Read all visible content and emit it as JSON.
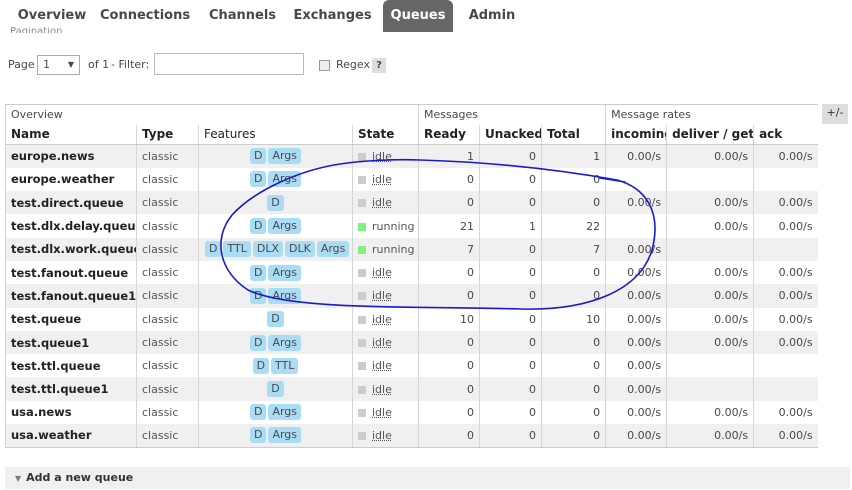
{
  "nav": {
    "tabs": [
      {
        "label": "Overview",
        "active": false
      },
      {
        "label": "Connections",
        "active": false
      },
      {
        "label": "Channels",
        "active": false
      },
      {
        "label": "Exchanges",
        "active": false
      },
      {
        "label": "Queues",
        "active": true
      },
      {
        "label": "Admin",
        "active": false
      }
    ]
  },
  "pagination": {
    "legend": "Pagination",
    "page_label": "Page",
    "page_value": "1",
    "of_label": "of 1",
    "filter_label": "- Filter:",
    "filter_value": "",
    "regex_label": "Regex",
    "help_label": "?"
  },
  "table": {
    "group_headers": {
      "overview": "Overview",
      "messages": "Messages",
      "message_rates": "Message rates"
    },
    "columns": [
      "Name",
      "Type",
      "Features",
      "State",
      "Ready",
      "Unacked",
      "Total",
      "incoming",
      "deliver / get",
      "ack"
    ],
    "plus_minus": "+/-",
    "rows": [
      {
        "name": "europe.news",
        "type": "classic",
        "features": [
          "D",
          "Args"
        ],
        "state": "idle",
        "ready": "1",
        "unacked": "0",
        "total": "1",
        "incoming": "0.00/s",
        "deliver": "0.00/s",
        "ack": "0.00/s"
      },
      {
        "name": "europe.weather",
        "type": "classic",
        "features": [
          "D",
          "Args"
        ],
        "state": "idle",
        "ready": "0",
        "unacked": "0",
        "total": "0",
        "incoming": "",
        "deliver": "",
        "ack": ""
      },
      {
        "name": "test.direct.queue",
        "type": "classic",
        "features": [
          "D"
        ],
        "state": "idle",
        "ready": "0",
        "unacked": "0",
        "total": "0",
        "incoming": "0.00/s",
        "deliver": "0.00/s",
        "ack": "0.00/s"
      },
      {
        "name": "test.dlx.delay.queue",
        "type": "classic",
        "features": [
          "D",
          "Args"
        ],
        "state": "running",
        "ready": "21",
        "unacked": "1",
        "total": "22",
        "incoming": "",
        "deliver": "0.00/s",
        "ack": "0.00/s"
      },
      {
        "name": "test.dlx.work.queue",
        "type": "classic",
        "features": [
          "D",
          "TTL",
          "DLX",
          "DLK",
          "Args"
        ],
        "state": "running",
        "ready": "7",
        "unacked": "0",
        "total": "7",
        "incoming": "0.00/s",
        "deliver": "",
        "ack": ""
      },
      {
        "name": "test.fanout.queue",
        "type": "classic",
        "features": [
          "D",
          "Args"
        ],
        "state": "idle",
        "ready": "0",
        "unacked": "0",
        "total": "0",
        "incoming": "0.00/s",
        "deliver": "0.00/s",
        "ack": "0.00/s"
      },
      {
        "name": "test.fanout.queue1",
        "type": "classic",
        "features": [
          "D",
          "Args"
        ],
        "state": "idle",
        "ready": "0",
        "unacked": "0",
        "total": "0",
        "incoming": "0.00/s",
        "deliver": "0.00/s",
        "ack": "0.00/s"
      },
      {
        "name": "test.queue",
        "type": "classic",
        "features": [
          "D"
        ],
        "state": "idle",
        "ready": "10",
        "unacked": "0",
        "total": "10",
        "incoming": "0.00/s",
        "deliver": "0.00/s",
        "ack": "0.00/s"
      },
      {
        "name": "test.queue1",
        "type": "classic",
        "features": [
          "D",
          "Args"
        ],
        "state": "idle",
        "ready": "0",
        "unacked": "0",
        "total": "0",
        "incoming": "0.00/s",
        "deliver": "0.00/s",
        "ack": "0.00/s"
      },
      {
        "name": "test.ttl.queue",
        "type": "classic",
        "features": [
          "D",
          "TTL"
        ],
        "state": "idle",
        "ready": "0",
        "unacked": "0",
        "total": "0",
        "incoming": "0.00/s",
        "deliver": "",
        "ack": ""
      },
      {
        "name": "test.ttl.queue1",
        "type": "classic",
        "features": [
          "D"
        ],
        "state": "idle",
        "ready": "0",
        "unacked": "0",
        "total": "0",
        "incoming": "0.00/s",
        "deliver": "",
        "ack": ""
      },
      {
        "name": "usa.news",
        "type": "classic",
        "features": [
          "D",
          "Args"
        ],
        "state": "idle",
        "ready": "0",
        "unacked": "0",
        "total": "0",
        "incoming": "0.00/s",
        "deliver": "0.00/s",
        "ack": "0.00/s"
      },
      {
        "name": "usa.weather",
        "type": "classic",
        "features": [
          "D",
          "Args"
        ],
        "state": "idle",
        "ready": "0",
        "unacked": "0",
        "total": "0",
        "incoming": "0.00/s",
        "deliver": "0.00/s",
        "ack": "0.00/s"
      }
    ]
  },
  "add_queue": {
    "label": "Add a new queue",
    "icon": "triangle-down-icon"
  },
  "colors": {
    "badge": "#aadcf6",
    "running": "#80f080",
    "idle": "#cccccc",
    "active_tab": "#666666",
    "annotation": "#1a1acc"
  }
}
